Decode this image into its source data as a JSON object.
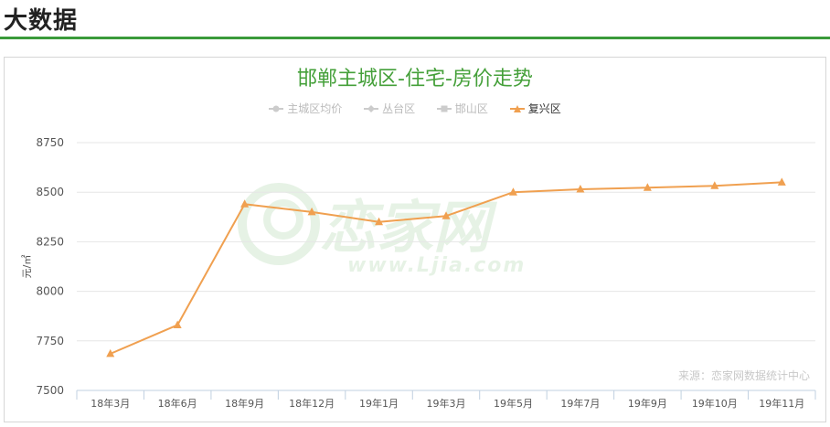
{
  "page": {
    "section_title": "大数据",
    "watermark_text": "恋家网",
    "watermark_url": "www.Ljia.com",
    "source_note": "来源：恋家网数据统计中心"
  },
  "legend": [
    {
      "label": "主城区均价",
      "marker": "circle",
      "active": false
    },
    {
      "label": "丛台区",
      "marker": "diamond",
      "active": false
    },
    {
      "label": "邯山区",
      "marker": "square",
      "active": false
    },
    {
      "label": "复兴区",
      "marker": "triangle",
      "active": true
    }
  ],
  "colors": {
    "active_series": "#f0a050",
    "inactive_legend": "#cccccc",
    "title": "#45a03a",
    "header_rule": "#3a9a3a"
  },
  "chart_data": {
    "type": "line",
    "title": "邯郸主城区-住宅-房价走势",
    "ylabel": "元/㎡",
    "xlabel": "",
    "categories": [
      "18年3月",
      "18年6月",
      "18年9月",
      "18年12月",
      "19年1月",
      "19年3月",
      "19年5月",
      "19年7月",
      "19年9月",
      "19年10月",
      "19年11月"
    ],
    "ylim": [
      7500,
      8750
    ],
    "yticks": [
      7500,
      7750,
      8000,
      8250,
      8500,
      8750
    ],
    "grid": true,
    "legend_position": "top-center",
    "series": [
      {
        "name": "复兴区",
        "color": "#f0a050",
        "marker": "triangle",
        "values": [
          7685,
          7830,
          8440,
          8400,
          8350,
          8380,
          8500,
          8515,
          8523,
          8532,
          8550
        ]
      }
    ]
  }
}
